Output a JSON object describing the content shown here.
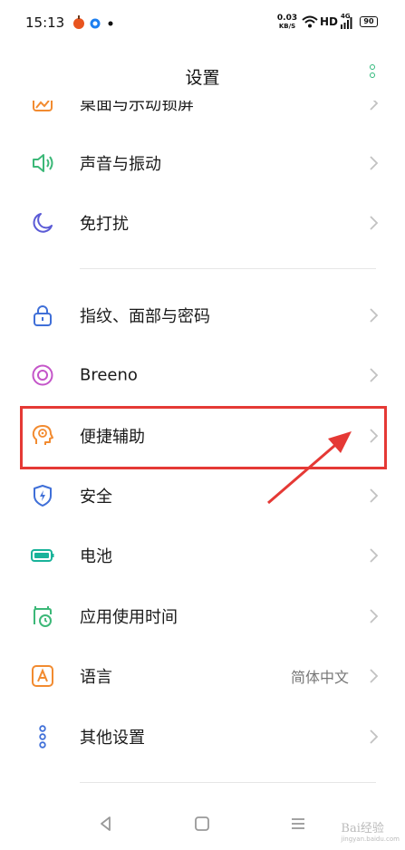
{
  "status_bar": {
    "time": "15:13",
    "net_speed_value": "0.03",
    "net_speed_unit": "KB/S",
    "hd_label": "HD",
    "network_label": "4G",
    "battery": "90"
  },
  "header": {
    "title": "设置"
  },
  "settings": [
    {
      "label": "桌面与示动锁屏",
      "icon": "wallpaper-icon"
    },
    {
      "label": "声音与振动",
      "icon": "speaker-icon"
    },
    {
      "label": "免打扰",
      "icon": "moon-icon"
    },
    {
      "label": "指纹、面部与密码",
      "icon": "lock-icon"
    },
    {
      "label": "Breeno",
      "icon": "breeno-icon"
    },
    {
      "label": "便捷辅助",
      "icon": "head-icon"
    },
    {
      "label": "安全",
      "icon": "shield-icon"
    },
    {
      "label": "电池",
      "icon": "battery-icon"
    },
    {
      "label": "应用使用时间",
      "icon": "clock-icon"
    },
    {
      "label": "语言",
      "icon": "language-icon",
      "value": "简体中文"
    },
    {
      "label": "其他设置",
      "icon": "more-settings-icon"
    }
  ],
  "watermark": {
    "text": "Bai经验",
    "sub": "jingyan.baidu.com"
  },
  "colors": {
    "accent_green": "#2fb87a",
    "highlight_red": "#e53935",
    "sound_green": "#3cb878",
    "moon_purple": "#5b5bd6",
    "lock_blue": "#3f6fd8",
    "breeno_pink": "#c455c9",
    "orange": "#f28b30",
    "teal": "#19b39a"
  }
}
